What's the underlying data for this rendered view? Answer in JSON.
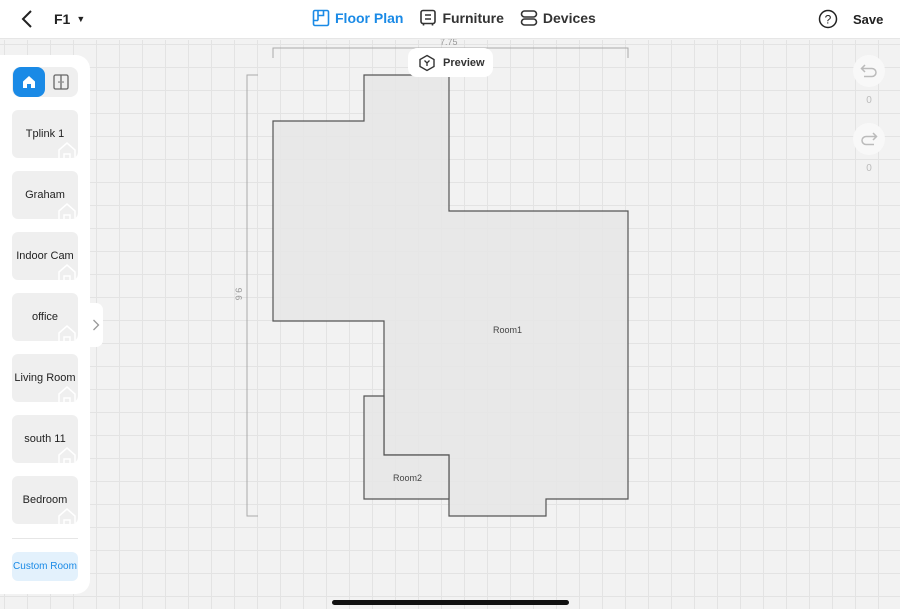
{
  "header": {
    "floor": "F1",
    "tabs": [
      {
        "label": "Floor Plan",
        "icon": "floor-plan-icon",
        "active": true
      },
      {
        "label": "Furniture",
        "icon": "furniture-icon",
        "active": false
      },
      {
        "label": "Devices",
        "icon": "devices-icon",
        "active": false
      }
    ],
    "save_label": "Save"
  },
  "sidebar": {
    "rooms": [
      "Tplink 1",
      "Graham",
      "Indoor Cam",
      "office",
      "Living Room",
      "south 11",
      "Bedroom"
    ],
    "custom_room_label": "Custom Room"
  },
  "canvas": {
    "preview_label": "Preview",
    "width_dim": "7.75",
    "height_dim": "9.6",
    "rooms": [
      {
        "name": "Room1"
      },
      {
        "name": "Room2"
      }
    ],
    "undo_count": "0",
    "redo_count": "0"
  },
  "colors": {
    "accent": "#1a8ae6",
    "room_fill": "#e6e6e6",
    "wall": "#555555"
  }
}
